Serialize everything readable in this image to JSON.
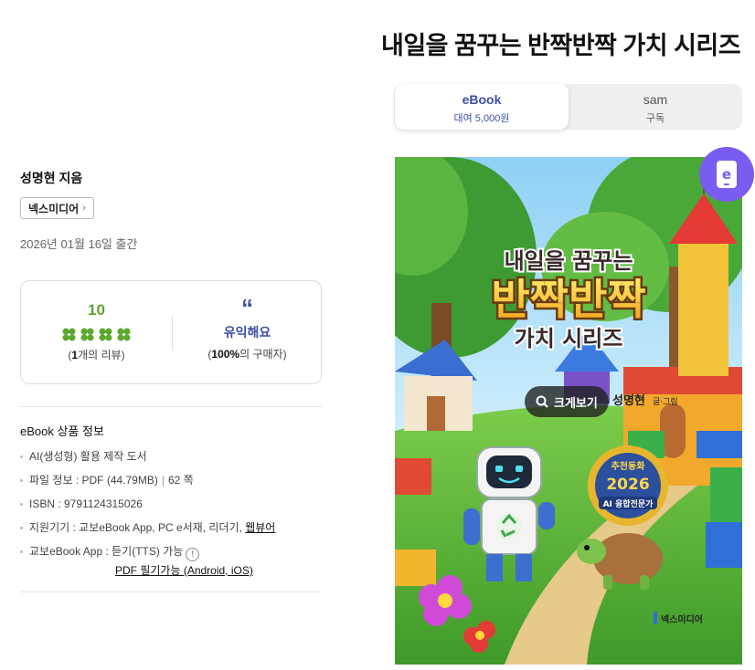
{
  "header": {
    "title": "내일을 꿈꾸는 반짝반짝 가치 시리즈"
  },
  "tabs": [
    {
      "label": "eBook",
      "sub": "대여 5,000원"
    },
    {
      "label": "sam",
      "sub": "구독"
    }
  ],
  "book": {
    "author": "성명현 지음",
    "publisher": "넥스미디어",
    "pub_date": "2026년 01월 16일 출간"
  },
  "review": {
    "score": "10",
    "count_prefix": "(",
    "count_value": "1",
    "count_suffix": "개의 리뷰)",
    "helpful_label": "유익해요",
    "helpful_pct": "100%",
    "helpful_suffix": "의 구매자)",
    "helpful_prefix": "(",
    "clover_color": "#5aa82e"
  },
  "info": {
    "title": "eBook 상품 정보",
    "ai_note": "AI(생성형) 활용 제작 도서",
    "file_label": "파일 정보 : PDF (44.79MB)",
    "file_sep": "|",
    "pages": "62 쪽",
    "isbn": "ISBN : 9791124315026",
    "devices_label": "지원기기 : 교보eBook App, PC e서재, 리더기, ",
    "devices_link": "웹뷰어",
    "app_label": "교보eBook App : 듣기(TTS) 가능",
    "info_icon": "!",
    "pdf_note": "PDF 필기가능 (Android, iOS)"
  },
  "cover": {
    "title_line1": "내일을 꿈꾸는",
    "title_line2": "반짝반짝",
    "title_line3": "가치 시리즈",
    "author": "성명현",
    "author_role": "글·그림",
    "seal_top": "추천동화",
    "seal_year": "2026",
    "seal_bottom": "AI 융합전문가",
    "publisher_logo": "넥스미디어",
    "badge_letter": "e",
    "zoom_label": "크게보기",
    "accent": "#7a5cf0"
  }
}
